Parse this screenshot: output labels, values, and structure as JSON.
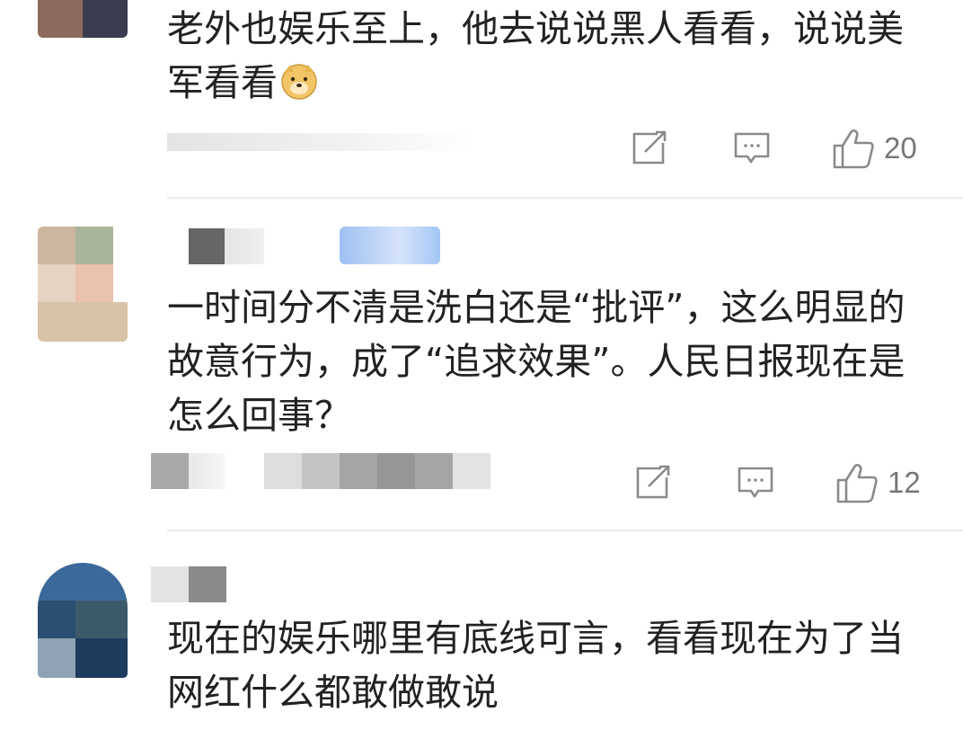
{
  "comments": [
    {
      "text": "老外也娱乐至上，他去说说黑人看看，说说美军看看",
      "emoji": "doge-emoji",
      "likes": "20"
    },
    {
      "text": "一时间分不清是洗白还是“批评”，这么明显的故意行为，成了“追求效果”。人民日报现在是怎么回事？",
      "likes": "12"
    },
    {
      "text": "现在的娱乐哪里有底线可言，看看现在为了当网红什么都敢做敢说"
    }
  ],
  "icons": {
    "share": "share-icon",
    "reply": "reply-icon",
    "like": "thumbs-up-icon"
  },
  "colors": {
    "text": "#222222",
    "icon": "#8a8a8a",
    "divider": "#ececec"
  }
}
